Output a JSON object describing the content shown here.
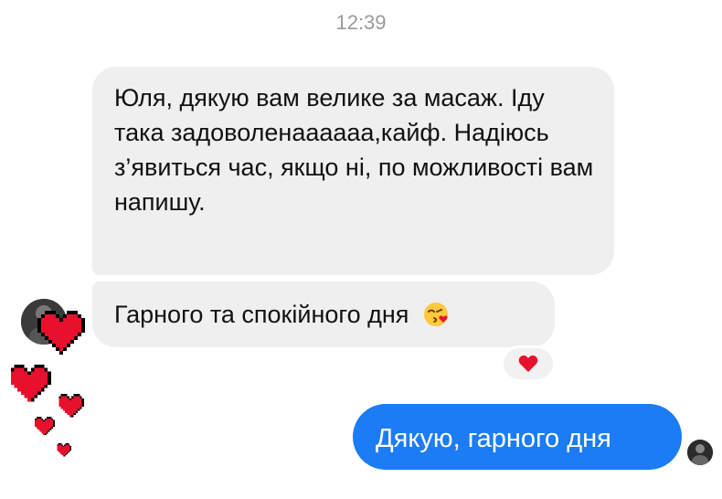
{
  "chat": {
    "timestamp": "12:39",
    "messages": [
      {
        "direction": "incoming",
        "text": "Юля, дякую вам велике за масаж. Іду така задоволенаааааа,кайф. Надіюсь з’явиться час, якщо ні, по можливості вам напишу."
      },
      {
        "direction": "incoming",
        "text": "Гарного та спокійного дня",
        "emoji": "kissing-face-with-heart-icon",
        "reaction": "heart-icon"
      },
      {
        "direction": "outgoing",
        "text": "Дякую, гарного дня"
      }
    ]
  },
  "colors": {
    "incoming_bubble": "#efefef",
    "outgoing_bubble": "#1b7cf5",
    "heart": "#e8112d",
    "timestamp": "#9a9a9a"
  },
  "decorations": {
    "pixel_hearts": "red pixel hearts overlay"
  }
}
